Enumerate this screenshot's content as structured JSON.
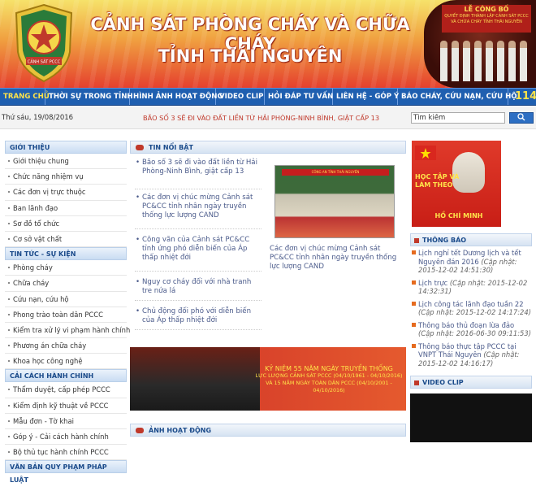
{
  "header": {
    "title_line1": "CẢNH SÁT PHÒNG CHÁY VÀ CHỮA CHÁY",
    "title_line2": "TỈNH THÁI NGUYÊN",
    "photo_banner_title": "LỄ CÔNG BỐ",
    "photo_banner_sub": "QUYẾT ĐỊNH THÀNH LẬP CẢNH SÁT PCCC VÀ CHỮA CHÁY TỈNH THÁI NGUYÊN"
  },
  "nav": {
    "items": [
      "TRANG CHỦ",
      "THỜI SỰ TRONG TỈNH",
      "HÌNH ẢNH HOẠT ĐỘNG",
      "VIDEO CLIP",
      "HỎI ĐÁP TƯ VẤN",
      "LIÊN HỆ - GÓP Ý",
      "BÁO CHÁY, CỨU NẠN, CỨU HỘ"
    ],
    "hotline": "114"
  },
  "datebar": {
    "date": "Thứ sáu, 19/08/2016",
    "marquee": "BÃO SỐ 3 SẼ ĐI VÀO ĐẤT LIỀN TỪ HẢI PHÒNG-NINH BÌNH, GIẬT CẤP 13",
    "search_value": "Tìm kiếm"
  },
  "sidebar": {
    "sections": [
      {
        "title": "GIỚI THIỆU",
        "items": [
          "Giới thiệu chung",
          "Chức năng nhiệm vụ",
          "Các đơn vị trực thuộc",
          "Ban lãnh đạo",
          "Sơ đồ tổ chức",
          "Cơ sở vật chất"
        ]
      },
      {
        "title": "TIN TỨC - SỰ KIỆN",
        "items": [
          "Phòng cháy",
          "Chữa cháy",
          "Cứu nạn, cứu hộ",
          "Phong trào toàn dân PCCC",
          "Kiểm tra xử lý vi phạm hành chính",
          "Phương án chữa cháy",
          "Khoa học công nghệ"
        ]
      },
      {
        "title": "CẢI CÁCH HÀNH CHÍNH",
        "items": [
          "Thẩm duyệt, cấp phép PCCC",
          "Kiểm định kỹ thuật về PCCC",
          "Mẫu đơn - Tờ khai",
          "Góp ý - Cải cách hành chính",
          "Bộ thủ tục hành chính PCCC"
        ]
      },
      {
        "title": "VĂN BẢN QUY PHẠM PHÁP LUẬT",
        "items": []
      }
    ]
  },
  "center": {
    "featured_title": "TIN NỔI BẬT",
    "news": [
      "Bão số 3 sẽ đi vào đất liền từ Hải Phòng-Ninh Bình, giật cấp 13",
      "Các đơn vị chúc mừng Cảnh sát PC&CC tỉnh nhân ngày truyền thống lực lượng CAND",
      "Công văn của Cảnh sát PC&CC tỉnh ứng phó diễn biến của Áp thấp nhiệt đới",
      "Nguy cơ cháy đối với nhà tranh tre nứa lá",
      "Chủ động đối phó với diễn biến của Áp thấp nhiệt đới"
    ],
    "featured_image_banner": "CÔNG AN TỈNH THÁI NGUYÊN",
    "featured_caption": "Các đơn vị chúc mừng Cảnh sát PC&CC tỉnh nhân ngày truyền thống lực lượng CAND",
    "promo_line1": "KỶ NIỆM 55 NĂM NGÀY TRUYỀN THỐNG",
    "promo_line2": "LỰC LƯỢNG CẢNH SÁT PCCC (04/10/1961 - 04/10/2016)",
    "promo_line3": "VÀ 15 NĂM NGÀY TOÀN DÂN PCCC (04/10/2001 - 04/10/2016)",
    "activities_title": "ẢNH HOẠT ĐỘNG"
  },
  "right": {
    "poster_text1": "HỌC TẬP VÀ LÀM THEO",
    "poster_text2": "HỒ CHÍ MINH",
    "notices_title": "THÔNG BÁO",
    "notices": [
      {
        "title": "Lịch nghỉ tết Dương lịch và tết Nguyên đán 2016",
        "updated": "(Cập nhật: 2015-12-02 14:51:30)"
      },
      {
        "title": "Lịch trực",
        "updated": "(Cập nhật: 2015-12-02 14:32:31)"
      },
      {
        "title": "Lịch công tác lãnh đạo tuần 22",
        "updated": "(Cập nhật: 2015-12-02 14:17:24)"
      },
      {
        "title": "Thông báo thủ đoạn lừa đảo",
        "updated": "(Cập nhật: 2016-06-30 09:11:53)"
      },
      {
        "title": "Thông báo thực tập PCCC tại VNPT Thái Nguyên",
        "updated": "(Cập nhật: 2015-12-02 14:16:17)"
      }
    ],
    "video_title": "VIDEO CLIP"
  },
  "colors": {
    "nav_bg": "#1f5fb0",
    "header_red": "#e5402e",
    "accent_yellow": "#ffe34a",
    "link": "#4a5a8a"
  }
}
